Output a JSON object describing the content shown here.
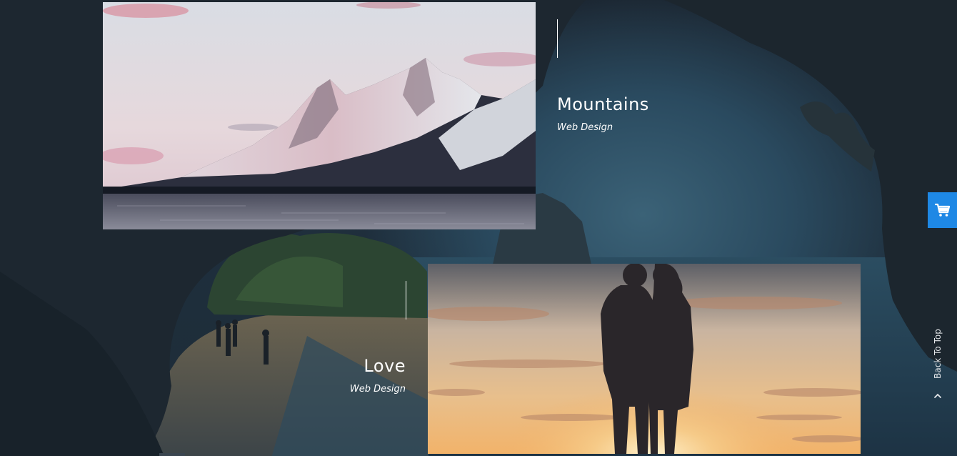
{
  "portfolio": {
    "items": [
      {
        "title": "Mountains",
        "category": "Web Design"
      },
      {
        "title": "Love",
        "category": "Web Design"
      }
    ]
  },
  "cart": {
    "icon": "shopping-cart-icon"
  },
  "back_to_top": {
    "label": "Back To Top",
    "icon": "chevron-up-icon"
  },
  "colors": {
    "accent": "#1e88e5",
    "background": "#1c2630",
    "text": "#ffffff"
  }
}
